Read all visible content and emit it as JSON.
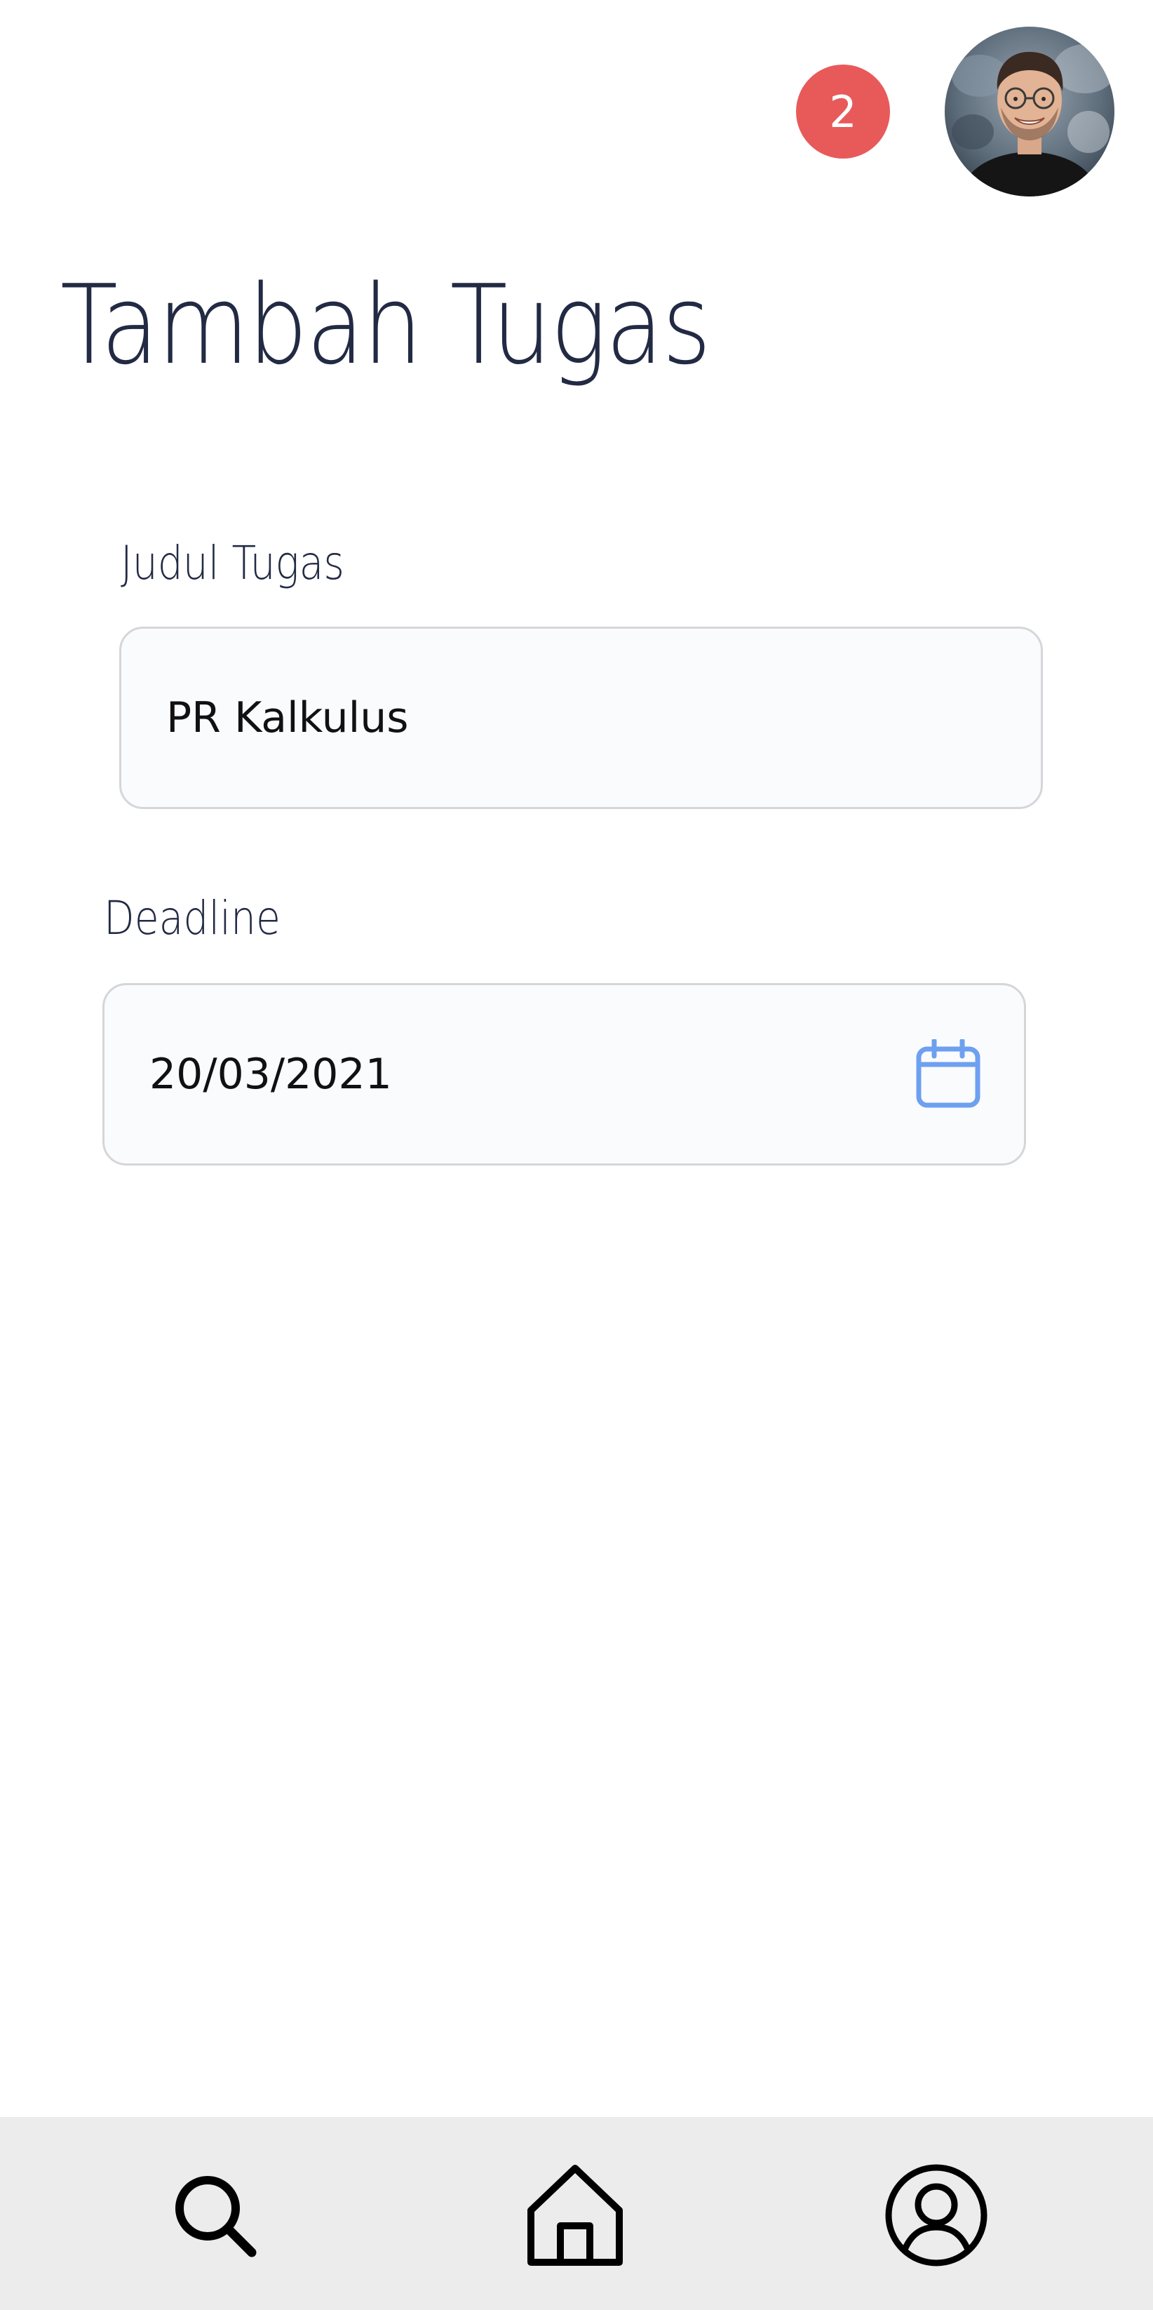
{
  "header": {
    "notification_count": "2",
    "notification_color": "#e85a5a",
    "avatar_icon": "user-photo"
  },
  "page": {
    "title": "Tambah Tugas"
  },
  "form": {
    "judul": {
      "label": "Judul Tugas",
      "value": "PR Kalkulus"
    },
    "deadline": {
      "label": "Deadline",
      "value": "20/03/2021",
      "icon": "calendar-icon",
      "icon_color": "#6ea0f0"
    }
  },
  "bottom_nav": {
    "background": "#ececec",
    "items": [
      {
        "icon": "search-icon"
      },
      {
        "icon": "home-icon"
      },
      {
        "icon": "profile-icon"
      }
    ]
  }
}
